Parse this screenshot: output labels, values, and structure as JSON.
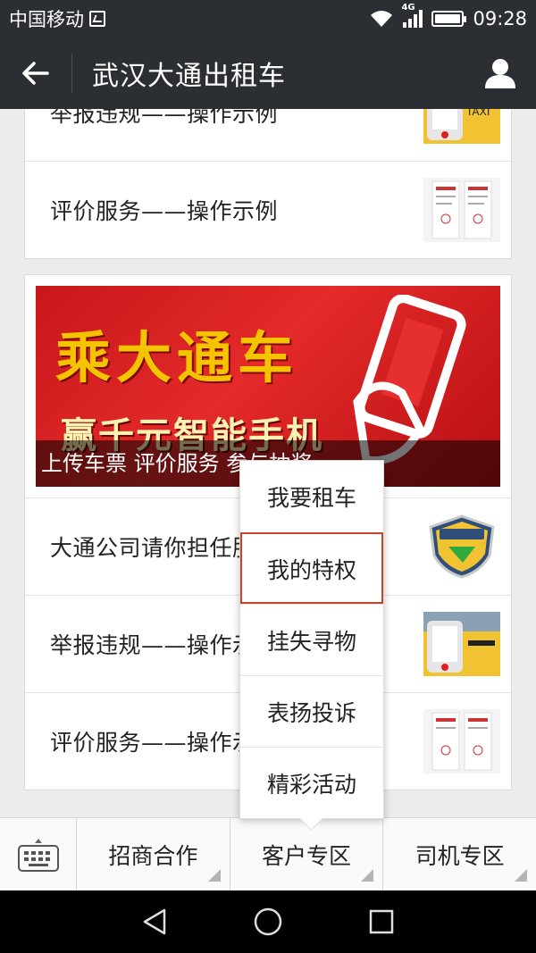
{
  "status": {
    "carrier": "中国移动",
    "network": "4G",
    "time": "09:28"
  },
  "header": {
    "title": "武汉大通出租车"
  },
  "topCard": {
    "rows": [
      {
        "label": "举报违规——操作示例"
      },
      {
        "label": "评价服务——操作示例"
      }
    ]
  },
  "newsCard": {
    "banner": {
      "headline": "乘大通车",
      "subline": "赢千元智能手机",
      "caption": "上传车票 评价服务 参与抽奖"
    },
    "rows": [
      {
        "label": "大通公司请你担任服务监督员"
      },
      {
        "label": "举报违规——操作示例"
      },
      {
        "label": "评价服务——操作示例"
      }
    ]
  },
  "popupMenu": {
    "items": [
      "我要租车",
      "我的特权",
      "挂失寻物",
      "表扬投诉",
      "精彩活动"
    ],
    "selected": "我的特权"
  },
  "bottomMenu": {
    "tabs": [
      "招商合作",
      "客户专区",
      "司机专区"
    ]
  },
  "colors": {
    "headerBg": "#2b2f33",
    "selectionBorder": "#c7432b",
    "bannerRed": "#d42020"
  }
}
